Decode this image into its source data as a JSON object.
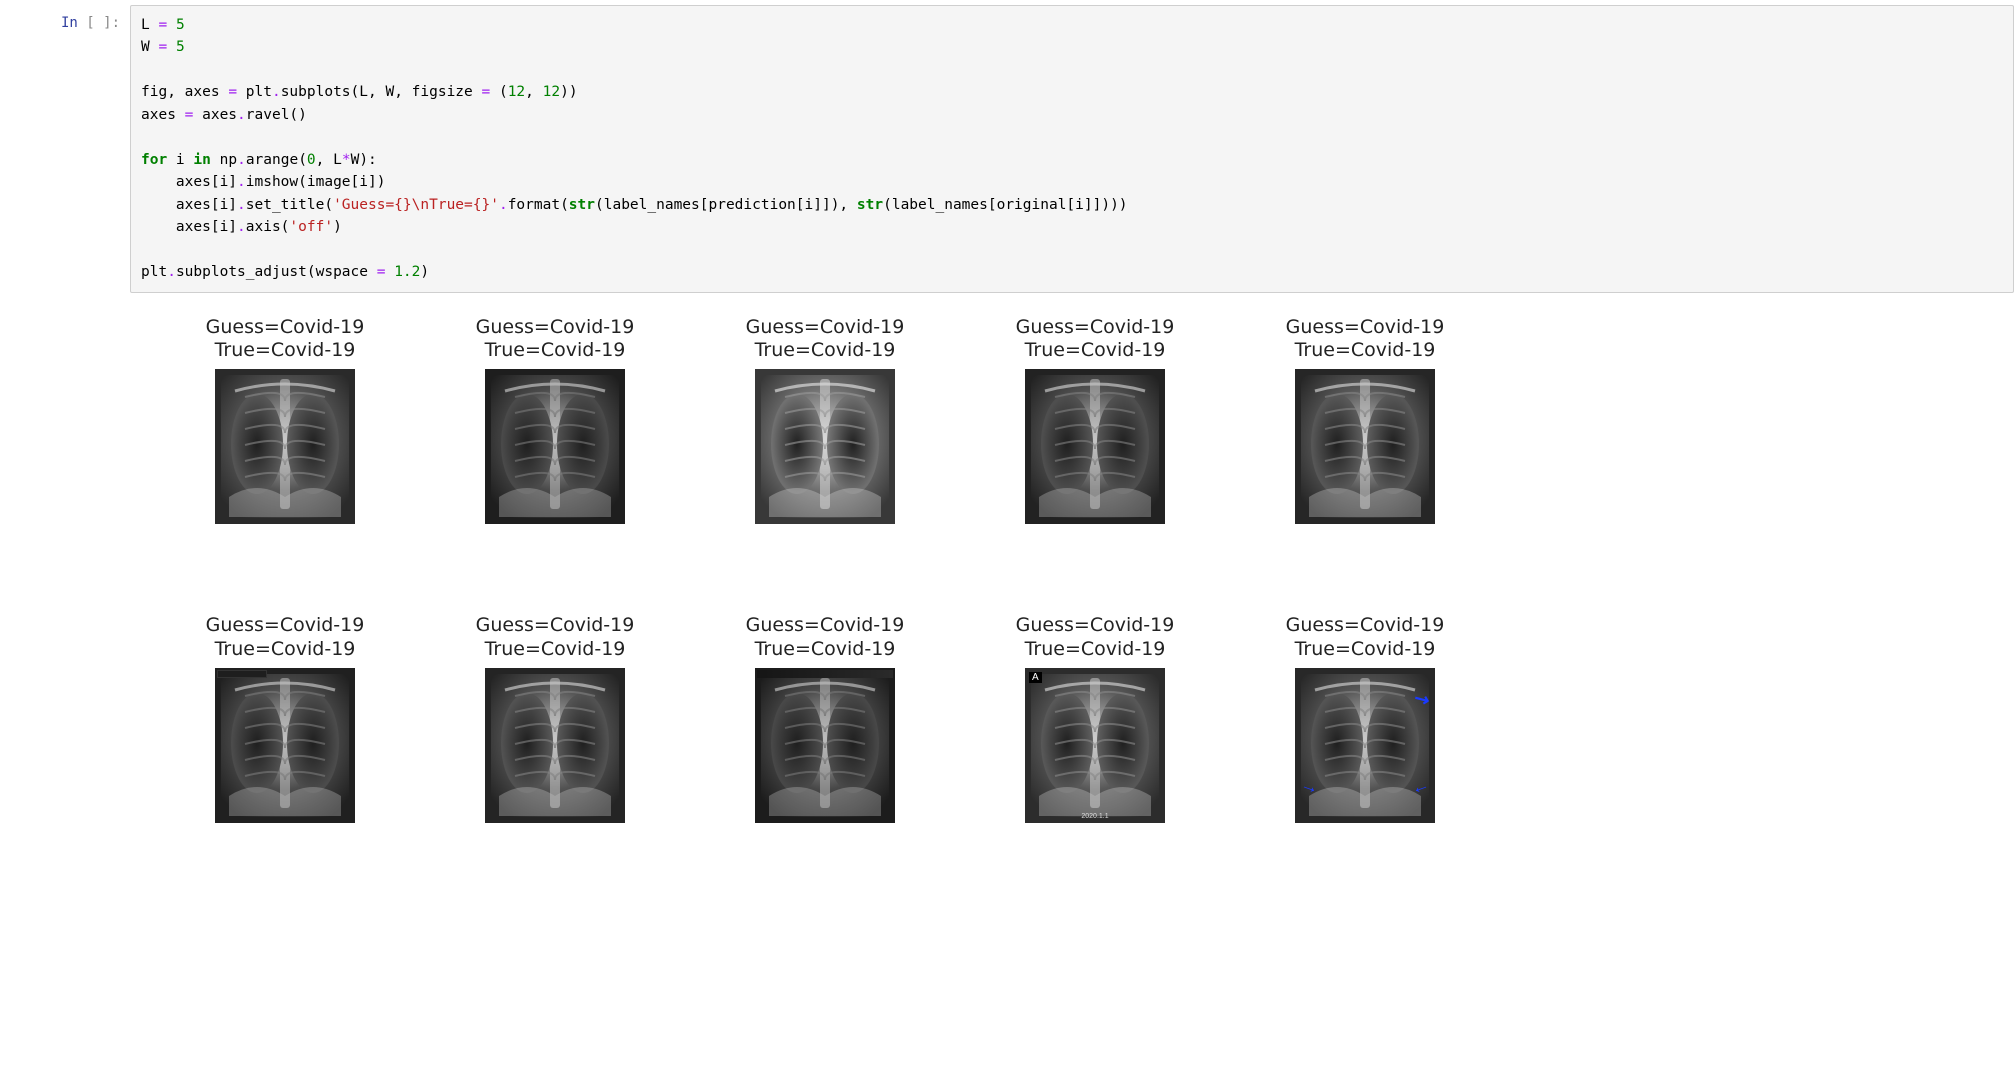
{
  "prompt": {
    "prefix": "In",
    "bracket_open": "[",
    "bracket_close": "]:",
    "number": " "
  },
  "code": {
    "line1_var": "L",
    "line1_eq": "=",
    "line1_val": "5",
    "line2_var": "W",
    "line2_eq": "=",
    "line2_val": "5",
    "line3a": "fig, axes ",
    "line3_eq": "=",
    "line3b": " plt",
    "line3_dot1": ".",
    "line3_sub": "subplots(L, W, figsize ",
    "line3_eq2": "=",
    "line3_paren": " (",
    "line3_n1": "12",
    "line3_comma": ", ",
    "line3_n2": "12",
    "line3_close": "))",
    "line4a": "axes ",
    "line4_eq": "=",
    "line4b": " axes",
    "line4_dot": ".",
    "line4_ravel": "ravel()",
    "line5_for": "for",
    "line5_i": " i ",
    "line5_in": "in",
    "line5_np": " np",
    "line5_dot": ".",
    "line5_arange": "arange(",
    "line5_n0": "0",
    "line5_mid": ", L",
    "line5_mul": "*",
    "line5_w": "W):",
    "line6a": "    axes[i]",
    "line6_dot": ".",
    "line6b": "imshow(image[i])",
    "line7a": "    axes[i]",
    "line7_dot": ".",
    "line7b": "set_title(",
    "line7_str": "'Guess={}\\nTrue={}'",
    "line7_dot2": ".",
    "line7_fmt": "format(",
    "line7_str2": "str",
    "line7c": "(label_names[prediction[i]]), ",
    "line7_str3": "str",
    "line7d": "(label_names[original[i]])))",
    "line8a": "    axes[i]",
    "line8_dot": ".",
    "line8b": "axis(",
    "line8_str": "'off'",
    "line8c": ")",
    "line9a": "plt",
    "line9_dot": ".",
    "line9b": "subplots_adjust(wspace ",
    "line9_eq": "=",
    "line9_sp": " ",
    "line9_val": "1.2",
    "line9c": ")"
  },
  "plots": [
    {
      "guess": "Covid-19",
      "true": "Covid-19",
      "variant": 0,
      "annot": []
    },
    {
      "guess": "Covid-19",
      "true": "Covid-19",
      "variant": 1,
      "annot": []
    },
    {
      "guess": "Covid-19",
      "true": "Covid-19",
      "variant": 2,
      "annot": []
    },
    {
      "guess": "Covid-19",
      "true": "Covid-19",
      "variant": 3,
      "annot": []
    },
    {
      "guess": "Covid-19",
      "true": "Covid-19",
      "variant": 4,
      "annot": []
    },
    {
      "guess": "Covid-19",
      "true": "Covid-19",
      "variant": 5,
      "annot": [
        "tag-bar2"
      ]
    },
    {
      "guess": "Covid-19",
      "true": "Covid-19",
      "variant": 6,
      "annot": []
    },
    {
      "guess": "Covid-19",
      "true": "Covid-19",
      "variant": 7,
      "annot": [
        "tag-bar"
      ]
    },
    {
      "guess": "Covid-19",
      "true": "Covid-19",
      "variant": 8,
      "annot": [
        "tag-a",
        "tag-date"
      ],
      "tagA": "A",
      "tagDate": "2020.1.1"
    },
    {
      "guess": "Covid-19",
      "true": "Covid-19",
      "variant": 9,
      "annot": [
        "arrows"
      ]
    }
  ],
  "title_prefix_guess": "Guess=",
  "title_prefix_true": "True="
}
